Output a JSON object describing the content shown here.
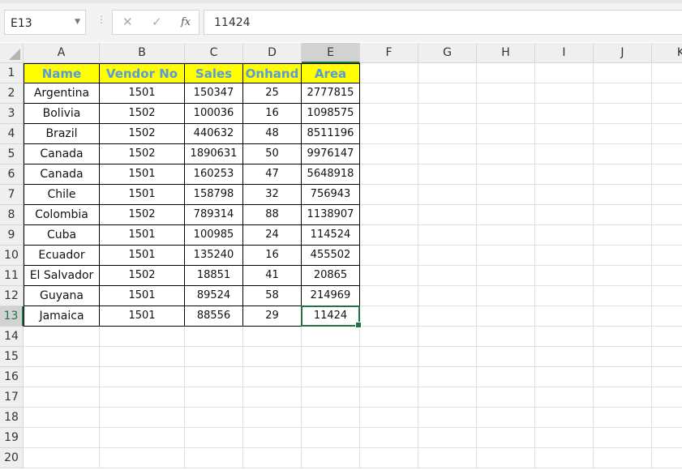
{
  "name_box": "E13",
  "formula_value": "11424",
  "icons": {
    "cancel": "✕",
    "enter": "✓",
    "fx": "fx"
  },
  "columns": [
    "A",
    "B",
    "C",
    "D",
    "E",
    "F",
    "G",
    "H",
    "I",
    "J",
    "K"
  ],
  "rows": [
    "1",
    "2",
    "3",
    "4",
    "5",
    "6",
    "7",
    "8",
    "9",
    "10",
    "11",
    "12",
    "13",
    "14",
    "15",
    "16",
    "17",
    "18",
    "19",
    "20"
  ],
  "table": {
    "headers": [
      "Name",
      "Vendor No",
      "Sales",
      "Onhand",
      "Area"
    ],
    "data": [
      [
        "Argentina",
        "1501",
        "150347",
        "25",
        "2777815"
      ],
      [
        "Bolivia",
        "1502",
        "100036",
        "16",
        "1098575"
      ],
      [
        "Brazil",
        "1502",
        "440632",
        "48",
        "8511196"
      ],
      [
        "Canada",
        "1502",
        "1890631",
        "50",
        "9976147"
      ],
      [
        "Canada",
        "1501",
        "160253",
        "47",
        "5648918"
      ],
      [
        "Chile",
        "1501",
        "158798",
        "32",
        "756943"
      ],
      [
        "Colombia",
        "1502",
        "789314",
        "88",
        "1138907"
      ],
      [
        "Cuba",
        "1501",
        "100985",
        "24",
        "114524"
      ],
      [
        "Ecuador",
        "1501",
        "135240",
        "16",
        "455502"
      ],
      [
        "El Salvador",
        "1502",
        "18851",
        "41",
        "20865"
      ],
      [
        "Guyana",
        "1501",
        "89524",
        "58",
        "214969"
      ],
      [
        "Jamaica",
        "1501",
        "88556",
        "29",
        "11424"
      ]
    ]
  },
  "colors": {
    "header_fill": "#ffff00",
    "header_text": "#5b9bd5",
    "selection": "#217346"
  }
}
